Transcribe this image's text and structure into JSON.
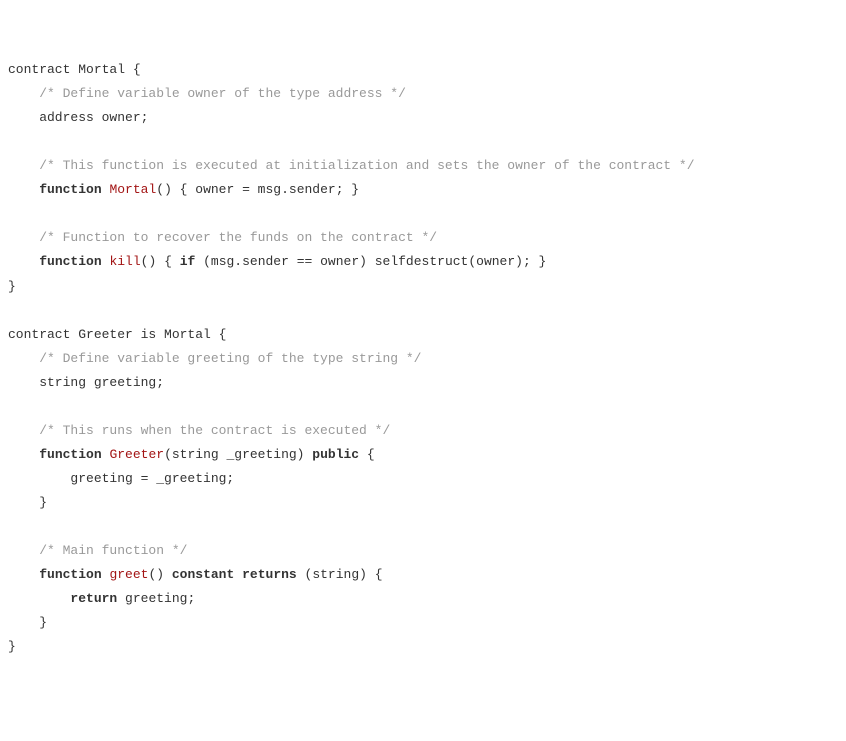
{
  "code": {
    "l1_a": "contract Mortal {",
    "l2_cm": "    /* Define variable owner of the type address */",
    "l3_a": "    address owner;",
    "l4_blank": "",
    "l5_cm": "    /* This function is executed at initialization and sets the owner of the contract */",
    "l6_pre": "    ",
    "l6_kw1": "function",
    "l6_sp1": " ",
    "l6_id": "Mortal",
    "l6_rest": "() { owner = msg.sender; }",
    "l7_blank": "",
    "l8_cm": "    /* Function to recover the funds on the contract */",
    "l9_pre": "    ",
    "l9_kw1": "function",
    "l9_sp1": " ",
    "l9_id": "kill",
    "l9_mid": "() { ",
    "l9_kw2": "if",
    "l9_rest": " (msg.sender == owner) selfdestruct(owner); }",
    "l10_a": "}",
    "l11_blank": "",
    "l12_a": "contract Greeter is Mortal {",
    "l13_cm": "    /* Define variable greeting of the type string */",
    "l14_a": "    string greeting;",
    "l15_blank": "",
    "l16_cm": "    /* This runs when the contract is executed */",
    "l17_pre": "    ",
    "l17_kw1": "function",
    "l17_sp1": " ",
    "l17_id": "Greeter",
    "l17_mid": "(string _greeting) ",
    "l17_kw2": "public",
    "l17_rest": " {",
    "l18_a": "        greeting = _greeting;",
    "l19_a": "    }",
    "l20_blank": "",
    "l21_cm": "    /* Main function */",
    "l22_pre": "    ",
    "l22_kw1": "function",
    "l22_sp1": " ",
    "l22_id": "greet",
    "l22_mid": "() ",
    "l22_kw2": "constant",
    "l22_sp2": " ",
    "l22_kw3": "returns",
    "l22_rest": " (string) {",
    "l23_pre": "        ",
    "l23_kw1": "return",
    "l23_rest": " greeting;",
    "l24_a": "    }",
    "l25_a": "}"
  }
}
